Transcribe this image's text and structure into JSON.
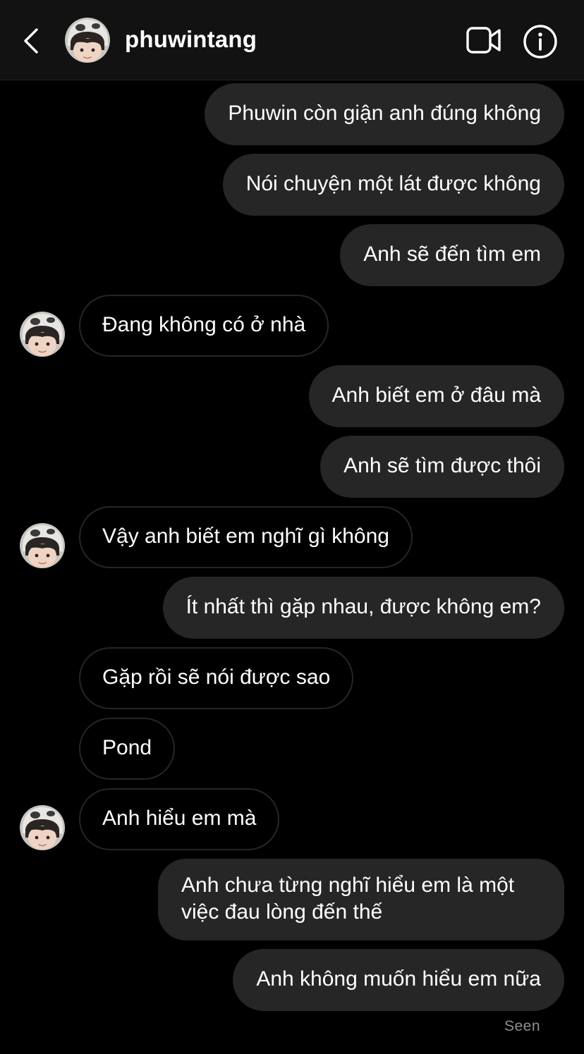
{
  "header": {
    "username": "phuwintang",
    "back_icon": "chevron-left-icon",
    "video_icon": "video-camera-icon",
    "info_icon": "info-circle-icon"
  },
  "messages": [
    {
      "direction": "out",
      "text": "Phuwin còn giận anh đúng không"
    },
    {
      "direction": "out",
      "text": "Nói chuyện một lát được không"
    },
    {
      "direction": "out",
      "text": "Anh sẽ đến tìm em"
    },
    {
      "direction": "in",
      "text": "Đang không có ở nhà",
      "avatar": true
    },
    {
      "direction": "out",
      "text": "Anh biết em ở đâu mà"
    },
    {
      "direction": "out",
      "text": "Anh sẽ tìm được thôi"
    },
    {
      "direction": "in",
      "text": "Vậy anh biết em nghĩ gì không",
      "avatar": true
    },
    {
      "direction": "out",
      "text": "Ít nhất thì gặp nhau, được không em?"
    },
    {
      "direction": "in",
      "text": "Gặp rồi sẽ nói được sao",
      "avatar": false
    },
    {
      "direction": "in",
      "text": "Pond",
      "avatar": false
    },
    {
      "direction": "in",
      "text": "Anh hiểu em mà",
      "avatar": true
    },
    {
      "direction": "out",
      "text": "Anh chưa từng nghĩ hiểu em là một việc đau lòng đến thế"
    },
    {
      "direction": "out",
      "text": "Anh không muốn hiểu em nữa"
    }
  ],
  "status": {
    "seen_label": "Seen"
  },
  "colors": {
    "background": "#000000",
    "header_bg": "#121212",
    "outgoing_bubble": "#262626",
    "incoming_border": "#262626",
    "text": "#ffffff",
    "muted_text": "#8e8e8e"
  }
}
